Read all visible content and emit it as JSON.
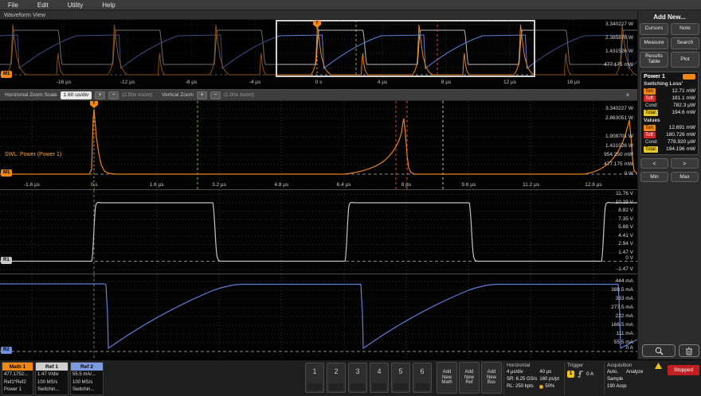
{
  "menu": {
    "items": [
      "File",
      "Edit",
      "Utility",
      "Help"
    ]
  },
  "view_title": "Waveform View",
  "overview": {
    "badge": "M1",
    "trigger_flag": "T",
    "yticks": [
      "3.340227 W",
      "2.385876 W",
      "1.431526 W",
      "477.175 mW"
    ],
    "xticks": [
      "-16 µs",
      "-12 µs",
      "-8 µs",
      "-4 µs",
      "0 s",
      "4 µs",
      "8 µs",
      "12 µs",
      "16 µs"
    ]
  },
  "zoombar": {
    "h_label": "Horizontal Zoom Scale",
    "h_scale": "1.60 us/div",
    "h_factor": "(2.50x zoom)",
    "v_label": "Vertical Zoom",
    "v_factor": "(1.00x zoom)",
    "plus": "+",
    "minus": "−",
    "close": "×"
  },
  "power_panel": {
    "badge": "M1",
    "trigger_flag": "T",
    "trace_label": "SWL: Power (Power 1)",
    "yticks": [
      "3.340227 W",
      "2.863051 W",
      "1.908701 W",
      "1.431526 W",
      "954.350 mW",
      "477.175 mW"
    ],
    "baseline": "0 W",
    "xticks": [
      "-1.6 µs",
      "0 s",
      "1.6 µs",
      "3.2 µs",
      "4.8 µs",
      "6.4 µs",
      "8 µs",
      "9.6 µs",
      "11.2 µs",
      "12.8 µs"
    ]
  },
  "voltage_panel": {
    "badge": "R1",
    "yticks": [
      "11.76 V",
      "10.29 V",
      "8.82 V",
      "7.35 V",
      "5.88 V",
      "4.41 V",
      "2.94 V",
      "1.47 V"
    ],
    "baseline": "0 V",
    "bottom_tick": "-1.47 V"
  },
  "current_panel": {
    "badge": "R2",
    "yticks": [
      "444 mA",
      "388.5 mA",
      "333 mA",
      "277.5 mA",
      "222 mA",
      "166.5 mA",
      "111 mA",
      "55.5 mA"
    ],
    "baseline": "0 A"
  },
  "sidebar": {
    "title": "Add New...",
    "buttons": {
      "cursors": "Cursors",
      "note": "Note",
      "measure": "Measure",
      "search": "Search",
      "results_table": "Results Table",
      "plot": "Plot"
    },
    "power_header": "Power 1",
    "section1_title": "Switching Loss'",
    "loss": {
      "ton_label": "Ton:",
      "ton": "12.71 mW",
      "toff_label": "Toff:",
      "toff": "181.1 mW",
      "cond_label": "Cond:",
      "cond": "782.3 µW",
      "total_label": "Total:",
      "total": "194.6 mW"
    },
    "section2_title": "Values",
    "values": {
      "ton_label": "Ton:",
      "ton": "12.691 mW",
      "toff_label": "Toff:",
      "toff": "180.726 mW",
      "cond_label": "Cond:",
      "cond": "778.920 µW",
      "total_label": "Total:",
      "total": "194.196 mW"
    },
    "prev": "<",
    "next": ">",
    "min": "Min",
    "max": "Max"
  },
  "bottombar": {
    "math1": {
      "title": "Math 1",
      "line1": "477.1752...",
      "line2": "Ref1*Ref2",
      "line3": "Power 1"
    },
    "ref1": {
      "title": "Ref 1",
      "line1": "1.47 V/div",
      "line2": "100 MS/s",
      "line3": "Switchin..."
    },
    "ref2": {
      "title": "Ref 2",
      "line1": "55.5 mA/...",
      "line2": "100 MS/s",
      "line3": "Switchin..."
    },
    "channels": [
      "1",
      "2",
      "3",
      "4",
      "5",
      "6"
    ],
    "add_math": "Add New Math",
    "add_ref": "Add New Ref",
    "add_bus": "Add New Bus",
    "horizontal": {
      "title": "Horizontal",
      "scale": "4 µs/div",
      "window": "40 µs",
      "sr": "SR: 6.25 GS/s",
      "res": "160 ps/pt",
      "rl": "RL: 250 kpts",
      "pos": "50%"
    },
    "trigger": {
      "title": "Trigger",
      "source": "1",
      "level": "0 A"
    },
    "acq": {
      "title": "Acquisition",
      "mode": "Auto,",
      "analyze": "Analyze",
      "type": "Sample",
      "count": "190 Acqs"
    },
    "stopped": "Stopped"
  }
}
